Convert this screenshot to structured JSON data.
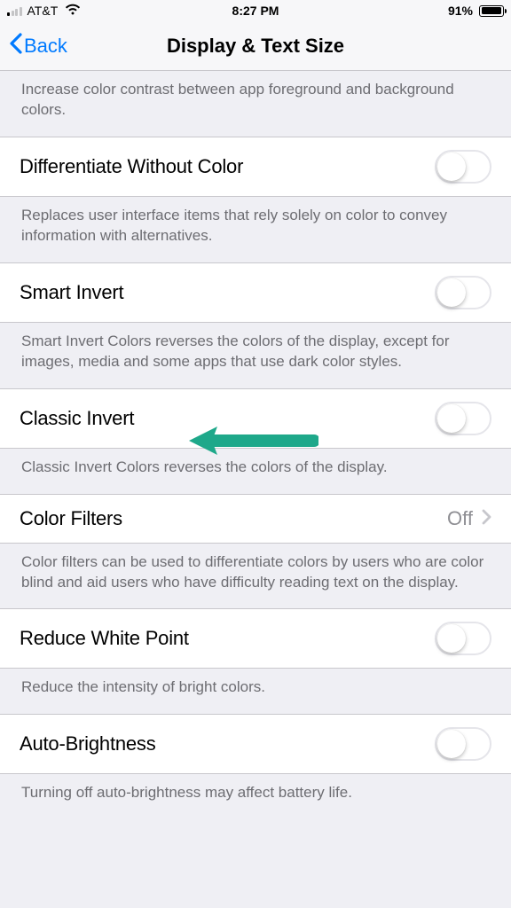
{
  "status": {
    "carrier": "AT&T",
    "time": "8:27 PM",
    "battery_percent": "91%"
  },
  "nav": {
    "back": "Back",
    "title": "Display & Text Size"
  },
  "sections": {
    "contrast_footer": "Increase color contrast between app foreground and background colors.",
    "diff_without_color": {
      "label": "Differentiate Without Color",
      "footer": "Replaces user interface items that rely solely on color to convey information with alternatives."
    },
    "smart_invert": {
      "label": "Smart Invert",
      "footer": "Smart Invert Colors reverses the colors of the display, except for images, media and some apps that use dark color styles."
    },
    "classic_invert": {
      "label": "Classic Invert",
      "footer": "Classic Invert Colors reverses the colors of the display."
    },
    "color_filters": {
      "label": "Color Filters",
      "value": "Off",
      "footer": "Color filters can be used to differentiate colors by users who are color blind and aid users who have difficulty reading text on the display."
    },
    "reduce_white_point": {
      "label": "Reduce White Point",
      "footer": "Reduce the intensity of bright colors."
    },
    "auto_brightness": {
      "label": "Auto-Brightness",
      "footer": "Turning off auto-brightness may affect battery life."
    }
  }
}
